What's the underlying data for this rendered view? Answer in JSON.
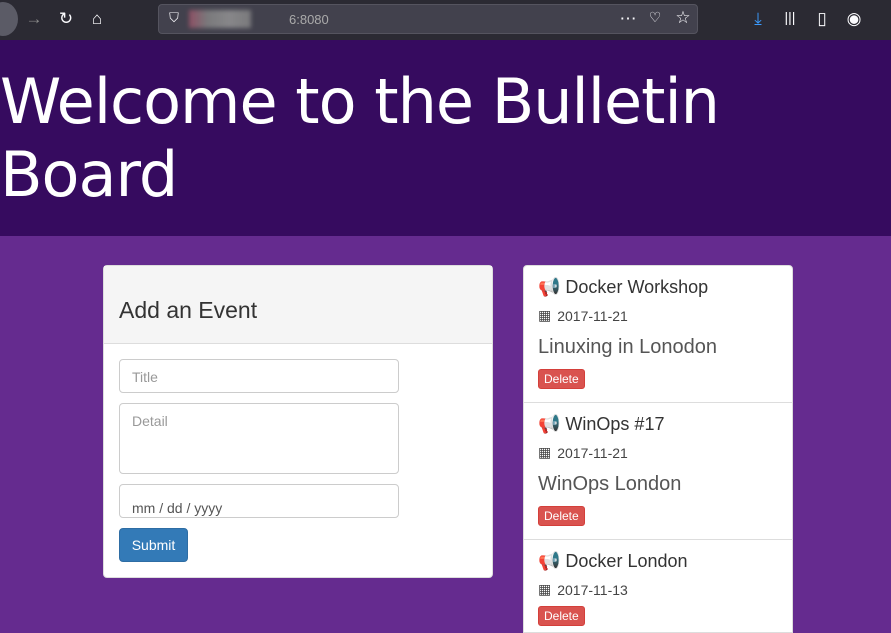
{
  "browser": {
    "url": "6:8080"
  },
  "hero": {
    "title": "Welcome to the Bulletin Board"
  },
  "form": {
    "heading": "Add an Event",
    "title_placeholder": "Title",
    "detail_placeholder": "Detail",
    "date_placeholder": "mm / dd / yyyy",
    "submit": "Submit"
  },
  "events": [
    {
      "title": "Docker Workshop",
      "date": "2017-11-21",
      "detail": "Linuxing in Lonodon",
      "delete": "Delete"
    },
    {
      "title": "WinOps #17",
      "date": "2017-11-21",
      "detail": "WinOps London",
      "delete": "Delete"
    },
    {
      "title": "Docker London",
      "date": "2017-11-13",
      "detail": "",
      "delete": "Delete"
    }
  ]
}
